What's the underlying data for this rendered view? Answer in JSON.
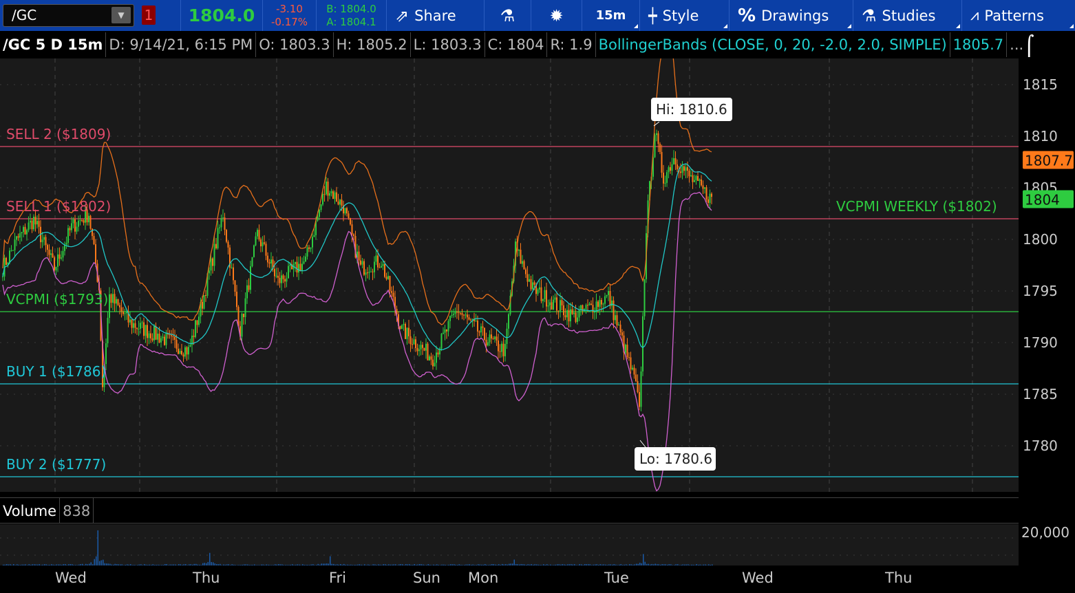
{
  "toolbar": {
    "symbol": "/GC",
    "alert_count": "1",
    "last": "1804.0",
    "change": "-3.10",
    "change_pct": "-0.17%",
    "bid": "B: 1804.0",
    "ask": "A: 1804.1",
    "share": "Share",
    "timeframe": "15m",
    "style": "Style",
    "drawings": "Drawings",
    "studies": "Studies",
    "patterns": "Patterns"
  },
  "infobar": {
    "title": "/GC 5 D 15m",
    "date": "D: 9/14/21, 6:15 PM",
    "open": "O: 1803.3",
    "high": "H: 1805.2",
    "low": "L: 1803.3",
    "close": "C: 1804",
    "range": "R: 1.9",
    "study": "BollingerBands (CLOSE, 0, 20, -2.0, 2.0, SIMPLE)",
    "study_value": "1805.7",
    "more": "..."
  },
  "colors": {
    "up": "#2ecc40",
    "down": "#ff7a1a",
    "upper_band": "#e8701a",
    "mid_band": "#20c8c8",
    "lower_band": "#d060d0",
    "sell": "#e04b6a",
    "vcpmi": "#2ecc40",
    "buy": "#20c8d8",
    "volume": "#1a5aa8"
  },
  "chart_data": {
    "type": "candlestick",
    "title": "/GC 5 D 15m",
    "ylim": [
      1776,
      1817
    ],
    "yticks": [
      1815,
      1810,
      1805,
      1800,
      1795,
      1790,
      1785,
      1780
    ],
    "xticks": [
      "Wed",
      "Thu",
      "Fri",
      "Sun",
      "Mon",
      "Tue",
      "Wed",
      "Thu"
    ],
    "close_keypoints": [
      [
        0,
        1797.2
      ],
      [
        8,
        1799.9
      ],
      [
        18,
        1801.9
      ],
      [
        30,
        1797.2
      ],
      [
        40,
        1801.2
      ],
      [
        50,
        1802.5
      ],
      [
        56,
        1795.2
      ],
      [
        58,
        1785.9
      ],
      [
        62,
        1794.5
      ],
      [
        74,
        1791.9
      ],
      [
        92,
        1790.5
      ],
      [
        108,
        1789.2
      ],
      [
        116,
        1793.9
      ],
      [
        128,
        1802.5
      ],
      [
        138,
        1791.2
      ],
      [
        148,
        1800.5
      ],
      [
        160,
        1795.9
      ],
      [
        176,
        1797.9
      ],
      [
        188,
        1805.2
      ],
      [
        198,
        1803.2
      ],
      [
        208,
        1797.2
      ],
      [
        220,
        1797.9
      ],
      [
        232,
        1791.2
      ],
      [
        250,
        1788.5
      ],
      [
        264,
        1793.2
      ],
      [
        280,
        1790.5
      ],
      [
        292,
        1789.2
      ],
      [
        298,
        1799.2
      ],
      [
        308,
        1795.2
      ],
      [
        332,
        1792.5
      ],
      [
        352,
        1794.5
      ],
      [
        368,
        1785.9
      ],
      [
        370,
        1783.2
      ],
      [
        374,
        1801.2
      ],
      [
        379,
        1810.5
      ],
      [
        384,
        1805.9
      ],
      [
        390,
        1807.9
      ],
      [
        400,
        1805.9
      ],
      [
        412,
        1803.9
      ]
    ],
    "levels": [
      {
        "label": "SELL 2 ($1809)",
        "price": 1809,
        "type": "sell"
      },
      {
        "label": "SELL 1 ($1802)",
        "price": 1802,
        "type": "sell"
      },
      {
        "label": "VCPMI  ($1793)",
        "price": 1793,
        "type": "vcpmi"
      },
      {
        "label": "BUY 1 ($1786)",
        "price": 1786,
        "type": "buy"
      },
      {
        "label": "BUY 2 ($1777)",
        "price": 1777,
        "type": "buy"
      }
    ],
    "weekly_label": "VCPMI WEEKLY ($1802)",
    "hi_label": "Hi: 1810.6",
    "lo_label": "Lo: 1780.6",
    "bollinger": {
      "length": 20,
      "stdev": 2.0
    },
    "price_tags": {
      "upper_band": "1807.7",
      "last": "1804"
    },
    "volume": {
      "label": "Volume",
      "value": "838",
      "tick": "20,000",
      "peaks": [
        [
          55,
          20000
        ],
        [
          120,
          7000
        ],
        [
          190,
          5000
        ],
        [
          297,
          3000
        ],
        [
          372,
          6000
        ]
      ]
    }
  }
}
